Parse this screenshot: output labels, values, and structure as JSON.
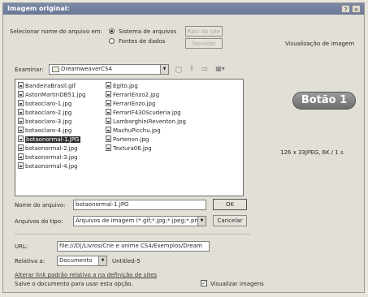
{
  "window": {
    "title": "Imagem original:",
    "help": "?",
    "close": "×"
  },
  "select_name": {
    "label": "Selecionar nome do arquivo em:",
    "option_filesystem": "Sistema de arquivos",
    "option_datasources": "Fontes de dados",
    "btn_site_root": "Raiz do site",
    "btn_server": "Servidor"
  },
  "lookin": {
    "label": "Examinar:",
    "value": "DreamweaverCS4"
  },
  "files_col1": [
    "BandeiraBrasil.gif",
    "AstonMartinDB51.jpg",
    "botaoclaro-1.jpg",
    "botaoclaro-2.jpg",
    "botaoclaro-3.jpg",
    "botaoclaro-4.jpg",
    "botaonormal-1.JPG",
    "botaonormal-2.jpg",
    "botaonormal-3.jpg",
    "botaonormal-4.jpg"
  ],
  "files_col2": [
    "Egito.jpg",
    "FerrariEnzo2.jpg",
    "FerrariEnzo.jpg",
    "FerrariF430Scuderia.jpg",
    "LamborghiniReventon.jpg",
    "MachuPicchu.jpg",
    "Partenon.jpg",
    "Textura06.jpg"
  ],
  "selected_file": "botaonormal-1.JPG",
  "preview": {
    "title": "Visualização de imagem",
    "button_text": "Botão 1",
    "info": "126 x 33JPEG, 6K / 1 s"
  },
  "filename": {
    "label": "Nome do arquivo:",
    "value": "botaonormal-1.JPG",
    "ok": "OK"
  },
  "filetype": {
    "label": "Arquivos do tipo:",
    "value": "Arquivos de imagem (*.gif;*.jpg;*.jpeg;*.png;*",
    "cancel": "Cancelar"
  },
  "url": {
    "label": "URL:",
    "value": "file:///D|/Livros/Crie e anime CS4/Exemplos/Dream"
  },
  "relative": {
    "label": "Relativa a:",
    "value": "Documento",
    "doc": "Untitled-5"
  },
  "footer": {
    "link": "Alterar link padrão relativo a na definição de sites",
    "note": "Salve o documento para usar esta opção.",
    "preview_images": "Visualizar imagens"
  }
}
